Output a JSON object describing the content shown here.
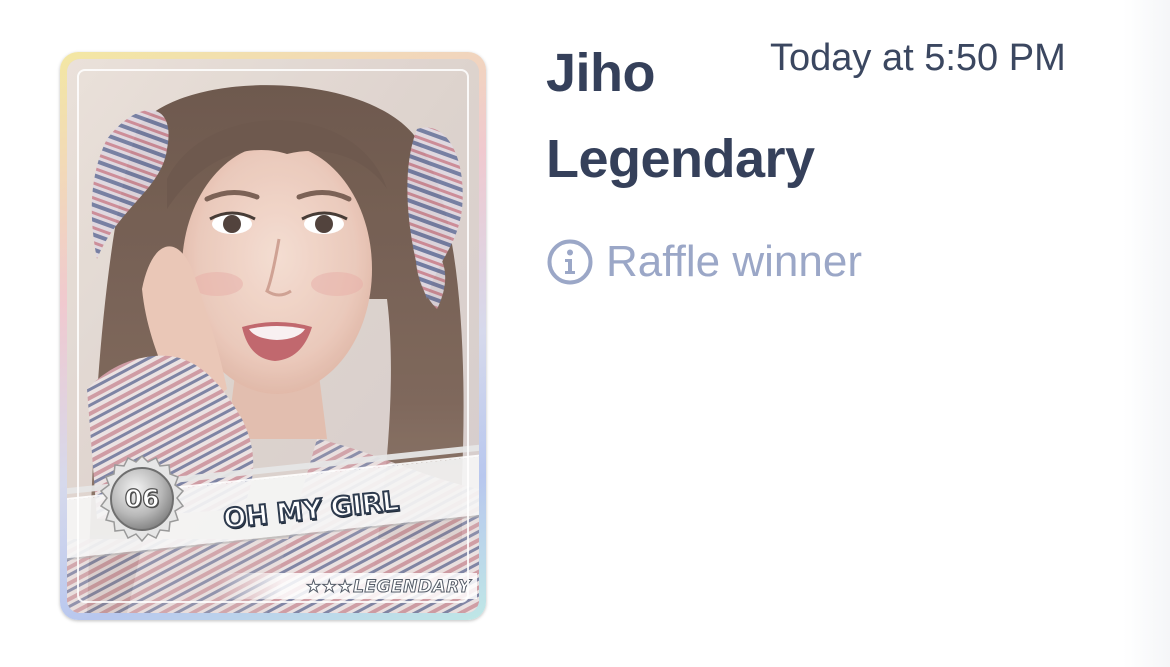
{
  "message": {
    "timestamp": "Today at 5:50 PM",
    "card_name": "Jiho",
    "rarity": "Legendary",
    "note": "Raffle winner",
    "note_icon": "info-icon"
  },
  "card": {
    "group": "OH MY GIRL",
    "number": "06",
    "rarity_label": "★★★LEGENDARY"
  },
  "colors": {
    "title_text": "#35405a",
    "timestamp_text": "#3b4760",
    "muted_text": "#9ba7c7",
    "background": "#ffffff"
  }
}
